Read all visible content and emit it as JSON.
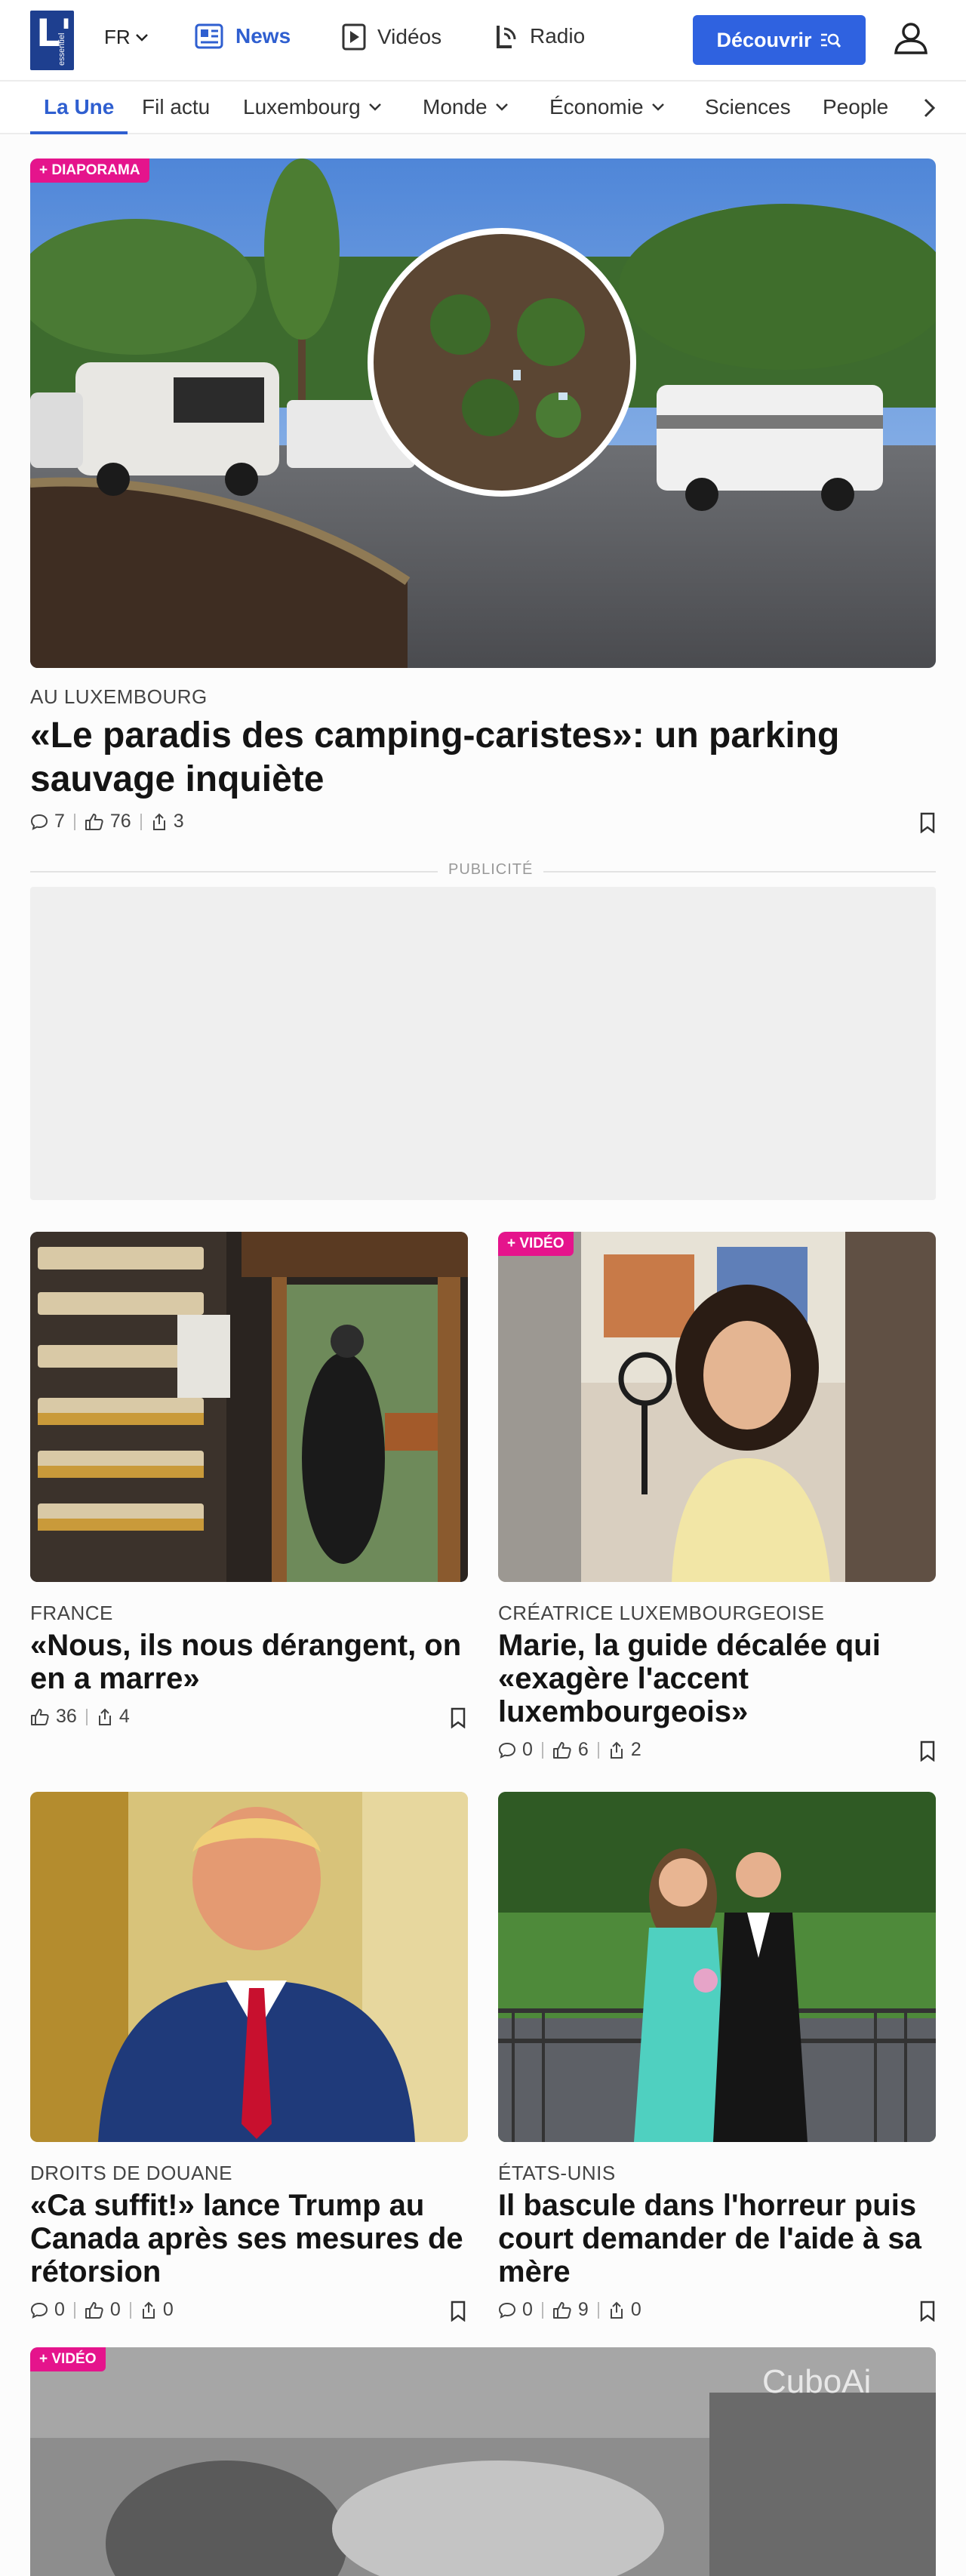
{
  "header": {
    "logo_letter": "L'",
    "logo_sub": "essentiel",
    "lang": "FR",
    "nav": [
      {
        "label": "News",
        "icon": "newspaper-icon"
      },
      {
        "label": "Vidéos",
        "icon": "play-icon"
      },
      {
        "label": "Radio",
        "icon": "radio-icon"
      }
    ],
    "cta_label": "Découvrir"
  },
  "subnav": {
    "items": [
      "La Une",
      "Fil actu",
      "Luxembourg",
      "Monde",
      "Économie",
      "Sciences",
      "People"
    ]
  },
  "hero": {
    "badge": "+ DIAPORAMA",
    "kicker": "AU LUXEMBOURG",
    "title_line1": "«Le paradis des camping-caristes»: un parking",
    "title_line2": "sauvage inquiète",
    "comments": "7",
    "likes": "76",
    "shares": "3"
  },
  "ad": {
    "label": "PUBLICITÉ"
  },
  "articles": [
    {
      "kicker": "FRANCE",
      "lines": [
        "«Nous, ils nous dérangent, on",
        "en a marre»"
      ],
      "likes": "36",
      "shares": "4"
    },
    {
      "badge": "+ VIDÉO",
      "kicker": "CRÉATRICE LUXEMBOURGEOISE",
      "lines": [
        "Marie, la guide décalée qui",
        "«exagère l'accent",
        "luxembourgeois»"
      ],
      "comments": "0",
      "likes": "6",
      "shares": "2"
    },
    {
      "kicker": "DROITS DE DOUANE",
      "lines": [
        "«Ca suffit!» lance Trump au",
        "Canada après ses mesures de",
        "rétorsion"
      ],
      "comments": "0",
      "likes": "0",
      "shares": "0"
    },
    {
      "kicker": "ÉTATS-UNIS",
      "lines": [
        "Il bascule dans l'horreur puis",
        "court demander de l'aide à sa",
        "mère"
      ],
      "comments": "0",
      "likes": "9",
      "shares": "0"
    },
    {
      "badge": "+ VIDÉO",
      "overlay_text": "CuboAi"
    }
  ],
  "colors": {
    "accent": "#2f62e0",
    "badge": "#e5148c"
  }
}
